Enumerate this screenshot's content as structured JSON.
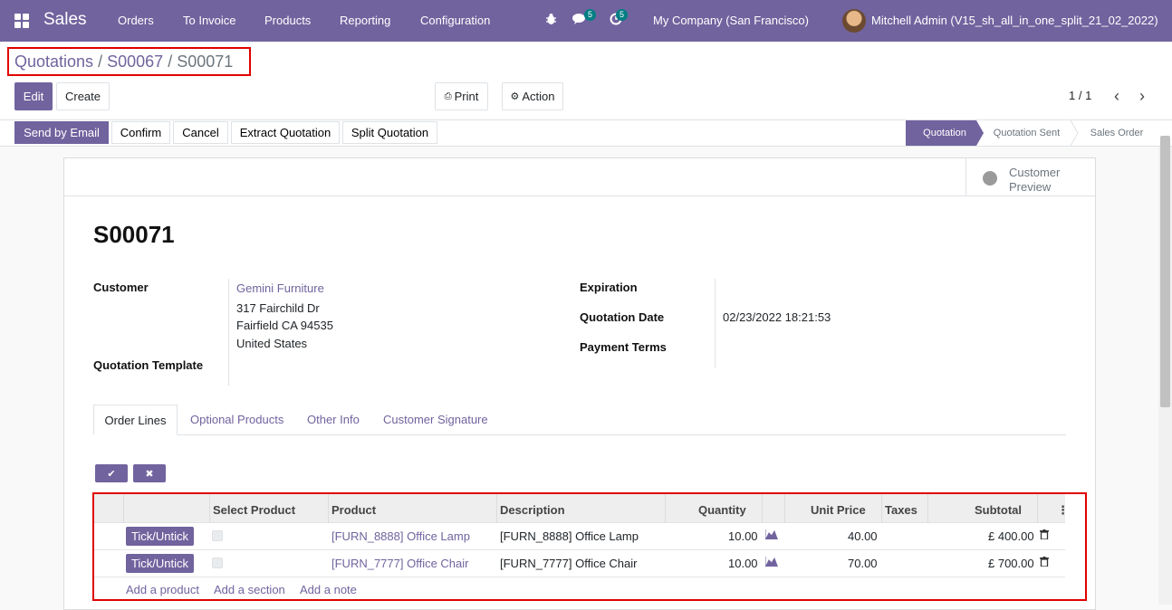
{
  "navbar": {
    "app_name": "Sales",
    "menu": [
      "Orders",
      "To Invoice",
      "Products",
      "Reporting",
      "Configuration"
    ],
    "messages_badge": "5",
    "activities_badge": "5",
    "company": "My Company (San Francisco)",
    "user": "Mitchell Admin (V15_sh_all_in_one_split_21_02_2022)",
    "bar_color": "#71639e"
  },
  "breadcrumb": {
    "items": [
      "Quotations",
      "S00067",
      "S00071"
    ],
    "separator": "/"
  },
  "control": {
    "edit_label": "Edit",
    "create_label": "Create",
    "print_label": "Print",
    "action_label": "Action",
    "pager": "1 / 1"
  },
  "statusbar": {
    "buttons": [
      "Send by Email",
      "Confirm",
      "Cancel",
      "Extract Quotation",
      "Split Quotation"
    ],
    "stages": [
      "Quotation",
      "Quotation Sent",
      "Sales Order"
    ],
    "active_stage": "Quotation"
  },
  "form": {
    "customer_preview": [
      "Customer",
      "Preview"
    ],
    "title": "S00071",
    "customer_label": "Customer",
    "customer_name": "Gemini Furniture",
    "address": [
      "317 Fairchild Dr",
      "Fairfield CA 94535",
      "United States"
    ],
    "quotation_template_label": "Quotation Template",
    "expiration_label": "Expiration",
    "quotation_date_label": "Quotation Date",
    "quotation_date": "02/23/2022 18:21:53",
    "payment_terms_label": "Payment Terms"
  },
  "tabs": [
    "Order Lines",
    "Optional Products",
    "Other Info",
    "Customer Signature"
  ],
  "order_lines": {
    "columns": [
      "Select Product",
      "Product",
      "Description",
      "Quantity",
      "Unit Price",
      "Taxes",
      "Subtotal"
    ],
    "rows": [
      {
        "tick": "Tick/Untick",
        "product": "[FURN_8888] Office Lamp",
        "description": "[FURN_8888] Office Lamp",
        "quantity": "10.00",
        "unit_price": "40.00",
        "subtotal": "£ 400.00"
      },
      {
        "tick": "Tick/Untick",
        "product": "[FURN_7777] Office Chair",
        "description": "[FURN_7777] Office Chair",
        "quantity": "10.00",
        "unit_price": "70.00",
        "subtotal": "£ 700.00"
      }
    ],
    "add_links": [
      "Add a product",
      "Add a section",
      "Add a note"
    ]
  }
}
